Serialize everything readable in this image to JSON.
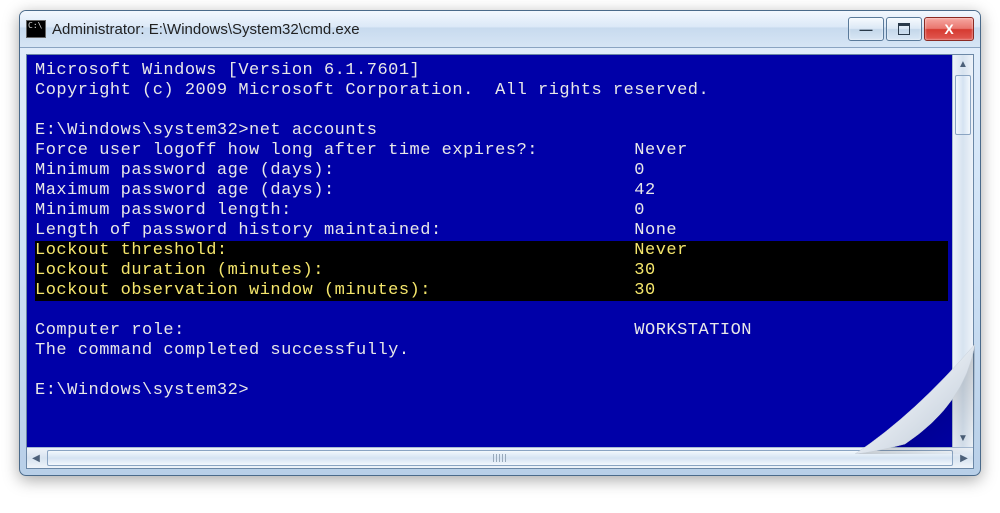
{
  "window": {
    "title": "Administrator: E:\\Windows\\System32\\cmd.exe"
  },
  "controls": {
    "minimize": "minimize",
    "maximize": "maximize",
    "close": "close"
  },
  "terminal": {
    "line_version": "Microsoft Windows [Version 6.1.7601]",
    "line_copyright": "Copyright (c) 2009 Microsoft Corporation.  All rights reserved.",
    "prompt1": "E:\\Windows\\system32>",
    "command1": "net accounts",
    "rows": [
      {
        "label": "Force user logoff how long after time expires?:",
        "value": "Never",
        "highlight": false
      },
      {
        "label": "Minimum password age (days):",
        "value": "0",
        "highlight": false
      },
      {
        "label": "Maximum password age (days):",
        "value": "42",
        "highlight": false
      },
      {
        "label": "Minimum password length:",
        "value": "0",
        "highlight": false
      },
      {
        "label": "Length of password history maintained:",
        "value": "None",
        "highlight": false
      },
      {
        "label": "Lockout threshold:",
        "value": "Never",
        "highlight": true
      },
      {
        "label": "Lockout duration (minutes):",
        "value": "30",
        "highlight": true
      },
      {
        "label": "Lockout observation window (minutes):",
        "value": "30",
        "highlight": true
      },
      {
        "label": "Computer role:",
        "value": "WORKSTATION",
        "highlight": false
      }
    ],
    "completion": "The command completed successfully.",
    "prompt2": "E:\\Windows\\system32>"
  }
}
